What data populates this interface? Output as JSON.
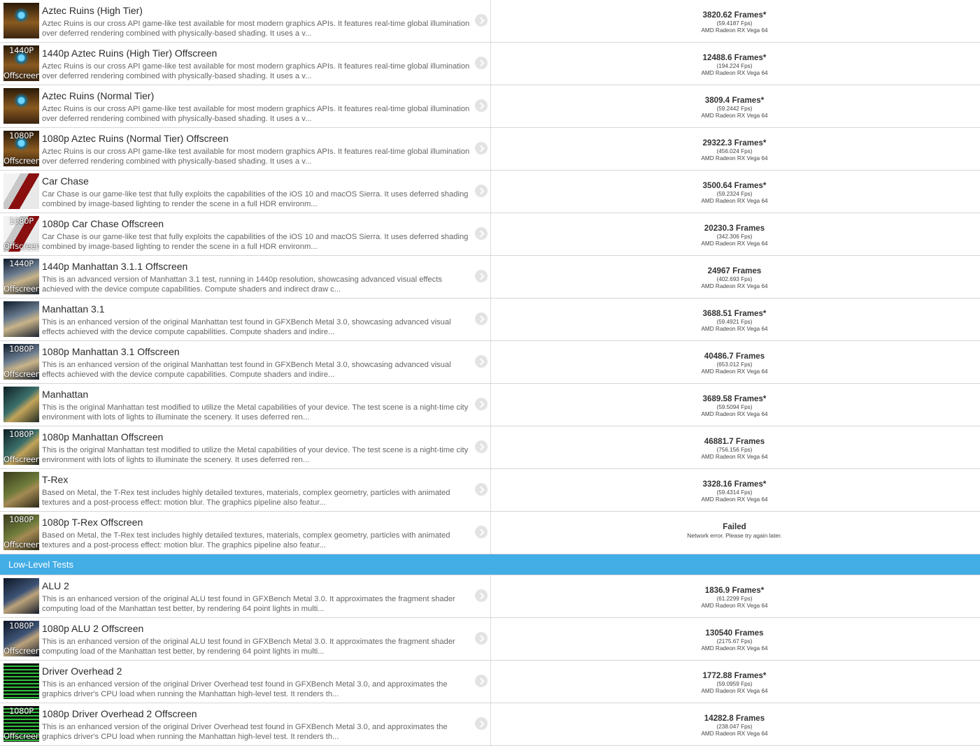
{
  "rows_top": [
    {
      "thumb": "t-aztec",
      "tag_top": "",
      "tag_bottom": "",
      "title": "Aztec Ruins (High Tier)",
      "desc": "Aztec Ruins is our cross API game-like test available for most modern graphics APIs. It features real-time global illumination over deferred rendering combined with physically-based shading. It uses a v...",
      "frames": "3820.62 Frames*",
      "fps": "(59.4187 Fps)",
      "gpu": "AMD Radeon RX Vega 64"
    },
    {
      "thumb": "t-aztec",
      "tag_top": "1440P",
      "tag_bottom": "Offscreen",
      "title": "1440p Aztec Ruins (High Tier) Offscreen",
      "desc": "Aztec Ruins is our cross API game-like test available for most modern graphics APIs. It features real-time global illumination over deferred rendering combined with physically-based shading. It uses a v...",
      "frames": "12488.6 Frames*",
      "fps": "(194.224 Fps)",
      "gpu": "AMD Radeon RX Vega 64"
    },
    {
      "thumb": "t-aztec",
      "tag_top": "",
      "tag_bottom": "",
      "title": "Aztec Ruins (Normal Tier)",
      "desc": "Aztec Ruins is our cross API game-like test available for most modern graphics APIs. It features real-time global illumination over deferred rendering combined with physically-based shading. It uses a v...",
      "frames": "3809.4 Frames*",
      "fps": "(59.2442 Fps)",
      "gpu": "AMD Radeon RX Vega 64"
    },
    {
      "thumb": "t-aztec",
      "tag_top": "1080P",
      "tag_bottom": "Offscreen",
      "title": "1080p Aztec Ruins (Normal Tier) Offscreen",
      "desc": "Aztec Ruins is our cross API game-like test available for most modern graphics APIs. It features real-time global illumination over deferred rendering combined with physically-based shading. It uses a v...",
      "frames": "29322.3 Frames*",
      "fps": "(456.024 Fps)",
      "gpu": "AMD Radeon RX Vega 64"
    },
    {
      "thumb": "t-car",
      "tag_top": "",
      "tag_bottom": "",
      "title": "Car Chase",
      "desc": "Car Chase is our game-like test that fully exploits the capabilities of the iOS 10 and macOS Sierra. It uses deferred shading combined by image-based lighting to render the scene in a full HDR environm...",
      "frames": "3500.64 Frames*",
      "fps": "(59.2324 Fps)",
      "gpu": "AMD Radeon RX Vega 64"
    },
    {
      "thumb": "t-car",
      "tag_top": "1080P",
      "tag_bottom": "Offscreen",
      "title": "1080p Car Chase Offscreen",
      "desc": "Car Chase is our game-like test that fully exploits the capabilities of the iOS 10 and macOS Sierra. It uses deferred shading combined by image-based lighting to render the scene in a full HDR environm...",
      "frames": "20230.3 Frames",
      "fps": "(342.306 Fps)",
      "gpu": "AMD Radeon RX Vega 64"
    },
    {
      "thumb": "t-man",
      "tag_top": "1440P",
      "tag_bottom": "Offscreen",
      "title": "1440p Manhattan 3.1.1 Offscreen",
      "desc": "This is an advanced version of Manhattan 3.1 test, running in 1440p resolution, showcasing advanced visual effects achieved with the device compute capabilities. Compute shaders and indirect draw c...",
      "frames": "24967 Frames",
      "fps": "(402.693 Fps)",
      "gpu": "AMD Radeon RX Vega 64"
    },
    {
      "thumb": "t-man",
      "tag_top": "",
      "tag_bottom": "",
      "title": "Manhattan 3.1",
      "desc": "This is an enhanced version of the original Manhattan test found in GFXBench Metal 3.0, showcasing advanced visual effects achieved with the device compute capabilities. Compute shaders and indire...",
      "frames": "3688.51 Frames*",
      "fps": "(59.4921 Fps)",
      "gpu": "AMD Radeon RX Vega 64"
    },
    {
      "thumb": "t-man",
      "tag_top": "1080P",
      "tag_bottom": "Offscreen",
      "title": "1080p Manhattan 3.1 Offscreen",
      "desc": "This is an enhanced version of the original Manhattan test found in GFXBench Metal 3.0, showcasing advanced visual effects achieved with the device compute capabilities. Compute shaders and indire...",
      "frames": "40486.7 Frames",
      "fps": "(653.012 Fps)",
      "gpu": "AMD Radeon RX Vega 64"
    },
    {
      "thumb": "t-manhattan",
      "tag_top": "",
      "tag_bottom": "",
      "title": "Manhattan",
      "desc": "This is the original Manhattan test modified to utilize the Metal capabilities of your device. The test scene is a night-time city environment with lots of lights to illuminate the scenery. It uses deferred ren...",
      "frames": "3689.58 Frames*",
      "fps": "(59.5094 Fps)",
      "gpu": "AMD Radeon RX Vega 64"
    },
    {
      "thumb": "t-manhattan",
      "tag_top": "1080P",
      "tag_bottom": "Offscreen",
      "title": "1080p Manhattan Offscreen",
      "desc": "This is the original Manhattan test modified to utilize the Metal capabilities of your device. The test scene is a night-time city environment with lots of lights to illuminate the scenery. It uses deferred ren...",
      "frames": "46881.7 Frames",
      "fps": "(756.156 Fps)",
      "gpu": "AMD Radeon RX Vega 64"
    },
    {
      "thumb": "t-trex",
      "tag_top": "",
      "tag_bottom": "",
      "title": "T-Rex",
      "desc": "Based on Metal, the T-Rex test includes highly detailed textures, materials, complex geometry, particles with animated textures and a post-process effect: motion blur. The graphics pipeline also featur...",
      "frames": "3328.16 Frames*",
      "fps": "(59.4314 Fps)",
      "gpu": "AMD Radeon RX Vega 64"
    },
    {
      "thumb": "t-trex",
      "tag_top": "1080P",
      "tag_bottom": "Offscreen",
      "title": "1080p T-Rex Offscreen",
      "desc": "Based on Metal, the T-Rex test includes highly detailed textures, materials, complex geometry, particles with animated textures and a post-process effect: motion blur. The graphics pipeline also featur...",
      "failed": "Failed",
      "error": "Network error. Please try again later."
    }
  ],
  "section": {
    "label": "Low-Level Tests"
  },
  "rows_bottom": [
    {
      "thumb": "t-alu",
      "tag_top": "",
      "tag_bottom": "",
      "title": "ALU 2",
      "desc": "This is an enhanced version of the original ALU test found in GFXBench Metal 3.0. It approximates the fragment shader computing load of the Manhattan test better, by rendering 64 point lights in multi...",
      "frames": "1836.9 Frames*",
      "fps": "(61.2299 Fps)",
      "gpu": "AMD Radeon RX Vega 64"
    },
    {
      "thumb": "t-alu",
      "tag_top": "1080P",
      "tag_bottom": "Offscreen",
      "title": "1080p ALU 2 Offscreen",
      "desc": "This is an enhanced version of the original ALU test found in GFXBench Metal 3.0. It approximates the fragment shader computing load of the Manhattan test better, by rendering 64 point lights in multi...",
      "frames": "130540 Frames",
      "fps": "(2175.67 Fps)",
      "gpu": "AMD Radeon RX Vega 64"
    },
    {
      "thumb": "t-drv",
      "tag_top": "",
      "tag_bottom": "",
      "title": "Driver Overhead 2",
      "desc": "This is an enhanced version of the original Driver Overhead test found in GFXBench Metal 3.0, and approximates the graphics driver's CPU load when running the Manhattan high-level test. It renders th...",
      "frames": "1772.88 Frames*",
      "fps": "(59.0959 Fps)",
      "gpu": "AMD Radeon RX Vega 64"
    },
    {
      "thumb": "t-drv",
      "tag_top": "1080P",
      "tag_bottom": "Offscreen",
      "title": "1080p Driver Overhead 2 Offscreen",
      "desc": "This is an enhanced version of the original Driver Overhead test found in GFXBench Metal 3.0, and approximates the graphics driver's CPU load when running the Manhattan high-level test. It renders th...",
      "frames": "14282.8 Frames",
      "fps": "(238.047 Fps)",
      "gpu": "AMD Radeon RX Vega 64"
    }
  ],
  "icons": {
    "row_action": "chevron-right-icon"
  },
  "colors": {
    "section_bg": "#43ade6",
    "row_border": "#d6d6d6"
  }
}
